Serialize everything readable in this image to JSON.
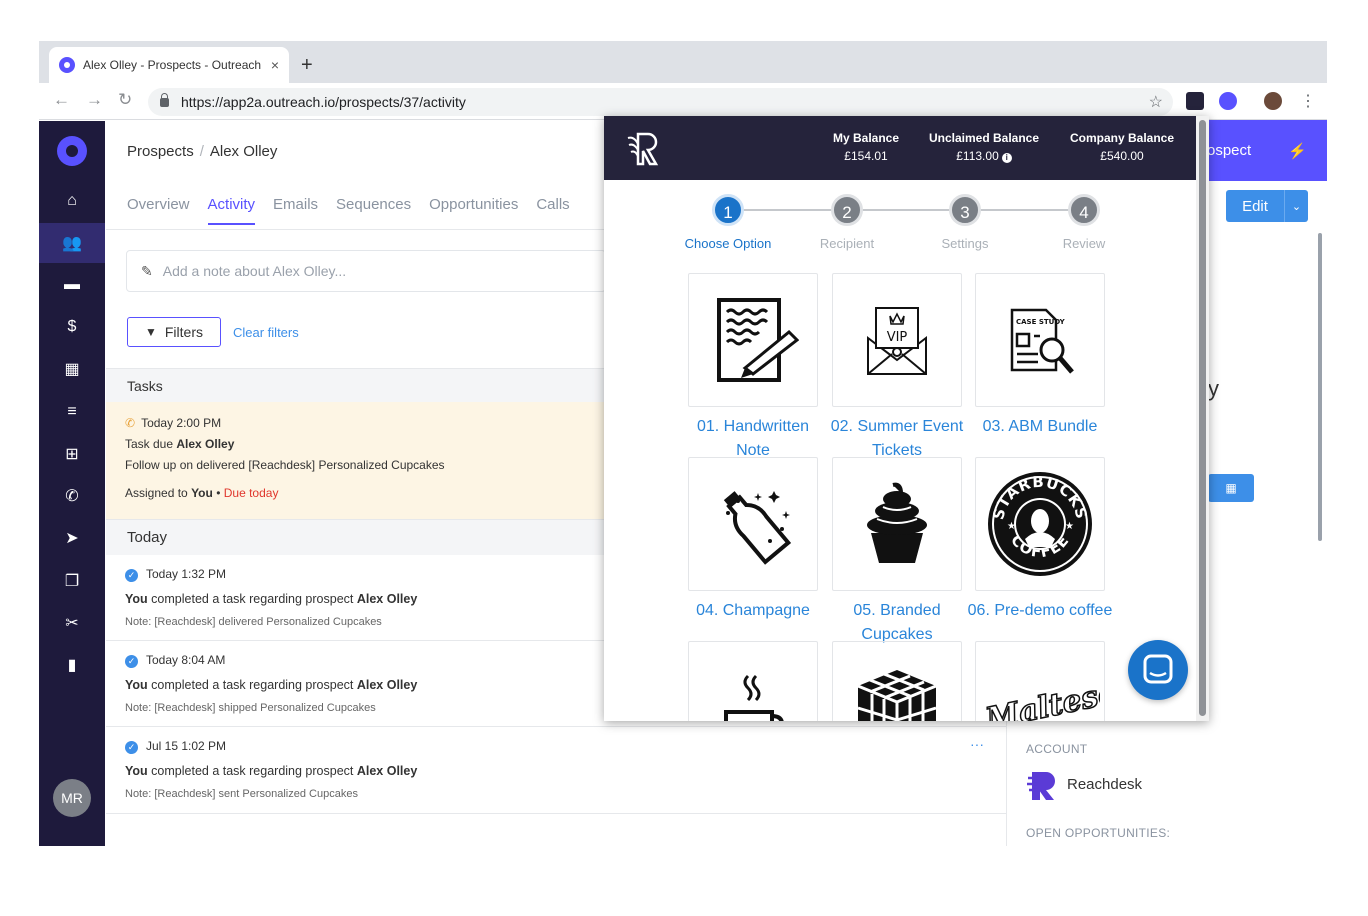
{
  "browser": {
    "tab_title": "Alex Olley - Prospects - Outreach",
    "tab_close": "×",
    "new_tab": "+",
    "url": "https://app2a.outreach.io/prospects/37/activity",
    "back": "←",
    "forward": "→",
    "reload": "↻",
    "star": "☆",
    "menu": "⋮"
  },
  "sidebar": {
    "items": [
      {
        "icon": "home-icon",
        "glyph": "⌂"
      },
      {
        "icon": "people-icon",
        "glyph": "👥"
      },
      {
        "icon": "briefcase-icon",
        "glyph": "▬"
      },
      {
        "icon": "dollar-icon",
        "glyph": "$"
      },
      {
        "icon": "calendar-icon",
        "glyph": "▦"
      },
      {
        "icon": "list-icon",
        "glyph": "≡"
      },
      {
        "icon": "inbox-icon",
        "glyph": "⊞"
      },
      {
        "icon": "phone-icon",
        "glyph": "✆"
      },
      {
        "icon": "send-icon",
        "glyph": "➤"
      },
      {
        "icon": "copy-icon",
        "glyph": "❐"
      },
      {
        "icon": "scissors-icon",
        "glyph": "✂"
      },
      {
        "icon": "chart-icon",
        "glyph": "▮"
      }
    ],
    "avatar": "MR"
  },
  "header": {
    "crumb_root": "Prospects",
    "crumb_sep": "/",
    "crumb_current": "Alex Olley"
  },
  "tabs": [
    "Overview",
    "Activity",
    "Emails",
    "Sequences",
    "Opportunities",
    "Calls"
  ],
  "note_placeholder": "Add a note about Alex Olley...",
  "filters_label": "Filters",
  "clear_filters": "Clear filters",
  "tasks_section": "Tasks",
  "task": {
    "time": "Today 2:00 PM",
    "due_prefix": "Task due",
    "due_name": "Alex Olley",
    "description": "Follow up on delivered [Reachdesk] Personalized Cupcakes",
    "assigned_prefix": "Assigned to",
    "assigned_to": "You",
    "bullet": "•",
    "due_status": "Due today"
  },
  "today_section": "Today",
  "activities": [
    {
      "time": "Today 1:32 PM",
      "actor": "You",
      "text": "completed a task regarding prospect",
      "prospect": "Alex Olley",
      "note": "Note: [Reachdesk] delivered Personalized Cupcakes"
    },
    {
      "time": "Today 8:04 AM",
      "actor": "You",
      "text": "completed a task regarding prospect",
      "prospect": "Alex Olley",
      "note": "Note: [Reachdesk] shipped Personalized Cupcakes"
    },
    {
      "time": "Jul 15 1:02 PM",
      "actor": "You",
      "text": "completed a task regarding prospect",
      "prospect": "Alex Olley",
      "note": "Note: [Reachdesk] sent Personalized Cupcakes"
    }
  ],
  "more_dots": "···",
  "right": {
    "prospect_btn": "ospect",
    "edit_btn": "Edit",
    "edit_caret": "⌄",
    "fragment_y": "y",
    "account_label": "ACCOUNT",
    "account_name": "Reachdesk",
    "opportunities_label": "OPEN OPPORTUNITIES:"
  },
  "reachdesk": {
    "balances": [
      {
        "label": "My Balance",
        "value": "£154.01"
      },
      {
        "label": "Unclaimed Balance",
        "value": "£113.00"
      },
      {
        "label": "Company Balance",
        "value": "£540.00"
      }
    ],
    "info_glyph": "i",
    "steps": [
      {
        "num": "1",
        "label": "Choose Option"
      },
      {
        "num": "2",
        "label": "Recipient"
      },
      {
        "num": "3",
        "label": "Settings"
      },
      {
        "num": "4",
        "label": "Review"
      }
    ],
    "active_step": 0,
    "options": [
      {
        "label": "01. Handwritten Note",
        "icon": "handwritten-note-icon"
      },
      {
        "label": "02. Summer Event Tickets",
        "icon": "vip-ticket-icon"
      },
      {
        "label": "03. ABM Bundle",
        "icon": "case-study-icon"
      },
      {
        "label": "04. Champagne",
        "icon": "champagne-icon"
      },
      {
        "label": "05. Branded Cupcakes",
        "icon": "cupcake-icon"
      },
      {
        "label": "06. Pre-demo coffee",
        "icon": "starbucks-coffee-icon"
      },
      {
        "label": "",
        "icon": "coffee-cup-icon"
      },
      {
        "label": "",
        "icon": "rubiks-cube-icon"
      },
      {
        "label": "",
        "icon": "maltesers-icon"
      }
    ],
    "vip_text": "VIP",
    "case_study_text": "CASE STUDY",
    "starbucks_top": "STARBUCKS",
    "starbucks_bottom": "COFFEE",
    "maltesers_text": "Maltesers"
  },
  "colors": {
    "sidebar": "#1e1a3c",
    "accent": "#5951ff",
    "link": "#3d8fe8",
    "popup_header": "#25233b",
    "step_active": "#1a73c9"
  }
}
